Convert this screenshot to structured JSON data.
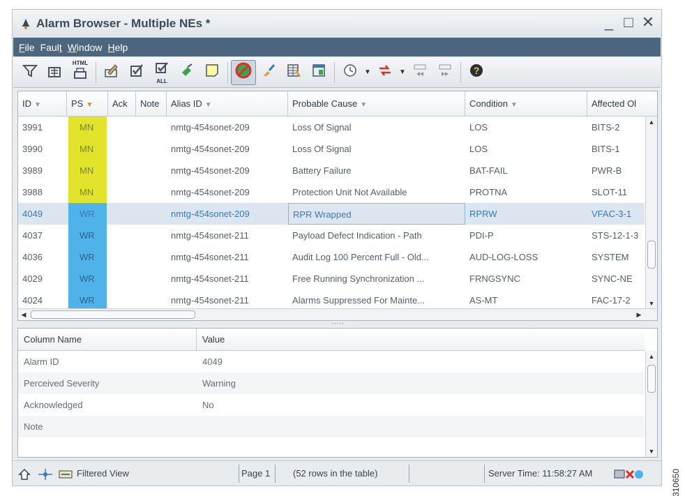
{
  "window": {
    "title": "Alarm Browser - Multiple NEs *",
    "controls": {
      "minimize": "_",
      "maximize": "□",
      "close": "✕"
    }
  },
  "menu": {
    "items": [
      "File",
      "Fault",
      "Window",
      "Help"
    ]
  },
  "toolbar": {
    "icons": [
      "filter-icon",
      "export-icon",
      "html-print-icon",
      "edit-icon",
      "acknowledge-icon",
      "acknowledge-all-icon",
      "clear-icon",
      "note-icon",
      "suppress-icon",
      "brush-icon",
      "columns-icon",
      "window-icon",
      "clock-icon",
      "dropdown-icon",
      "navigate-icon",
      "dropdown-icon",
      "prev-page-icon",
      "next-page-icon",
      "help-icon"
    ],
    "html_label": "HTML",
    "all_label": "ALL"
  },
  "table": {
    "columns": [
      "ID",
      "PS",
      "Ack",
      "Note",
      "Alias ID",
      "Probable Cause",
      "Condition",
      "Affected Ol"
    ],
    "rows": [
      {
        "id": "3991",
        "ps": "MN",
        "ack": "",
        "note": "",
        "alias": "nmtg-454sonet-209",
        "cause": "Loss Of Signal",
        "condition": "LOS",
        "affected": "BITS-2"
      },
      {
        "id": "3990",
        "ps": "MN",
        "ack": "",
        "note": "",
        "alias": "nmtg-454sonet-209",
        "cause": "Loss Of Signal",
        "condition": "LOS",
        "affected": "BITS-1"
      },
      {
        "id": "3989",
        "ps": "MN",
        "ack": "",
        "note": "",
        "alias": "nmtg-454sonet-209",
        "cause": "Battery Failure",
        "condition": "BAT-FAIL",
        "affected": "PWR-B"
      },
      {
        "id": "3988",
        "ps": "MN",
        "ack": "",
        "note": "",
        "alias": "nmtg-454sonet-209",
        "cause": "Protection Unit Not Available",
        "condition": "PROTNA",
        "affected": "SLOT-11"
      },
      {
        "id": "4049",
        "ps": "WR",
        "ack": "",
        "note": "",
        "alias": "nmtg-454sonet-209",
        "cause": "RPR Wrapped",
        "condition": "RPRW",
        "affected": "VFAC-3-1",
        "selected": true
      },
      {
        "id": "4037",
        "ps": "WR",
        "ack": "",
        "note": "",
        "alias": "nmtg-454sonet-211",
        "cause": "Payload Defect Indication - Path",
        "condition": "PDI-P",
        "affected": "STS-12-1-3"
      },
      {
        "id": "4036",
        "ps": "WR",
        "ack": "",
        "note": "",
        "alias": "nmtg-454sonet-211",
        "cause": "Audit Log 100 Percent Full - Old...",
        "condition": "AUD-LOG-LOSS",
        "affected": "SYSTEM"
      },
      {
        "id": "4029",
        "ps": "WR",
        "ack": "",
        "note": "",
        "alias": "nmtg-454sonet-211",
        "cause": "Free Running Synchronization ...",
        "condition": "FRNGSYNC",
        "affected": "SYNC-NE"
      },
      {
        "id": "4024",
        "ps": "WR",
        "ack": "",
        "note": "",
        "alias": "nmtg-454sonet-211",
        "cause": "Alarms Suppressed For Mainte...",
        "condition": "AS-MT",
        "affected": "FAC-17-2"
      }
    ],
    "colors": {
      "mn": "#e2e42c",
      "wr": "#4fb3ea",
      "selected_row": "#dbe6f1"
    }
  },
  "details": {
    "columns": [
      "Column Name",
      "Value"
    ],
    "rows": [
      {
        "name": "Alarm ID",
        "value": "4049"
      },
      {
        "name": "Perceived Severity",
        "value": "Warning"
      },
      {
        "name": "Acknowledged",
        "value": "No"
      },
      {
        "name": "Note",
        "value": ""
      }
    ]
  },
  "status": {
    "filtered": "Filtered View",
    "page": "Page 1",
    "rows": "(52  rows in the table)",
    "server_time": "Server Time: 11:58:27 AM"
  },
  "figure_id": "310650"
}
